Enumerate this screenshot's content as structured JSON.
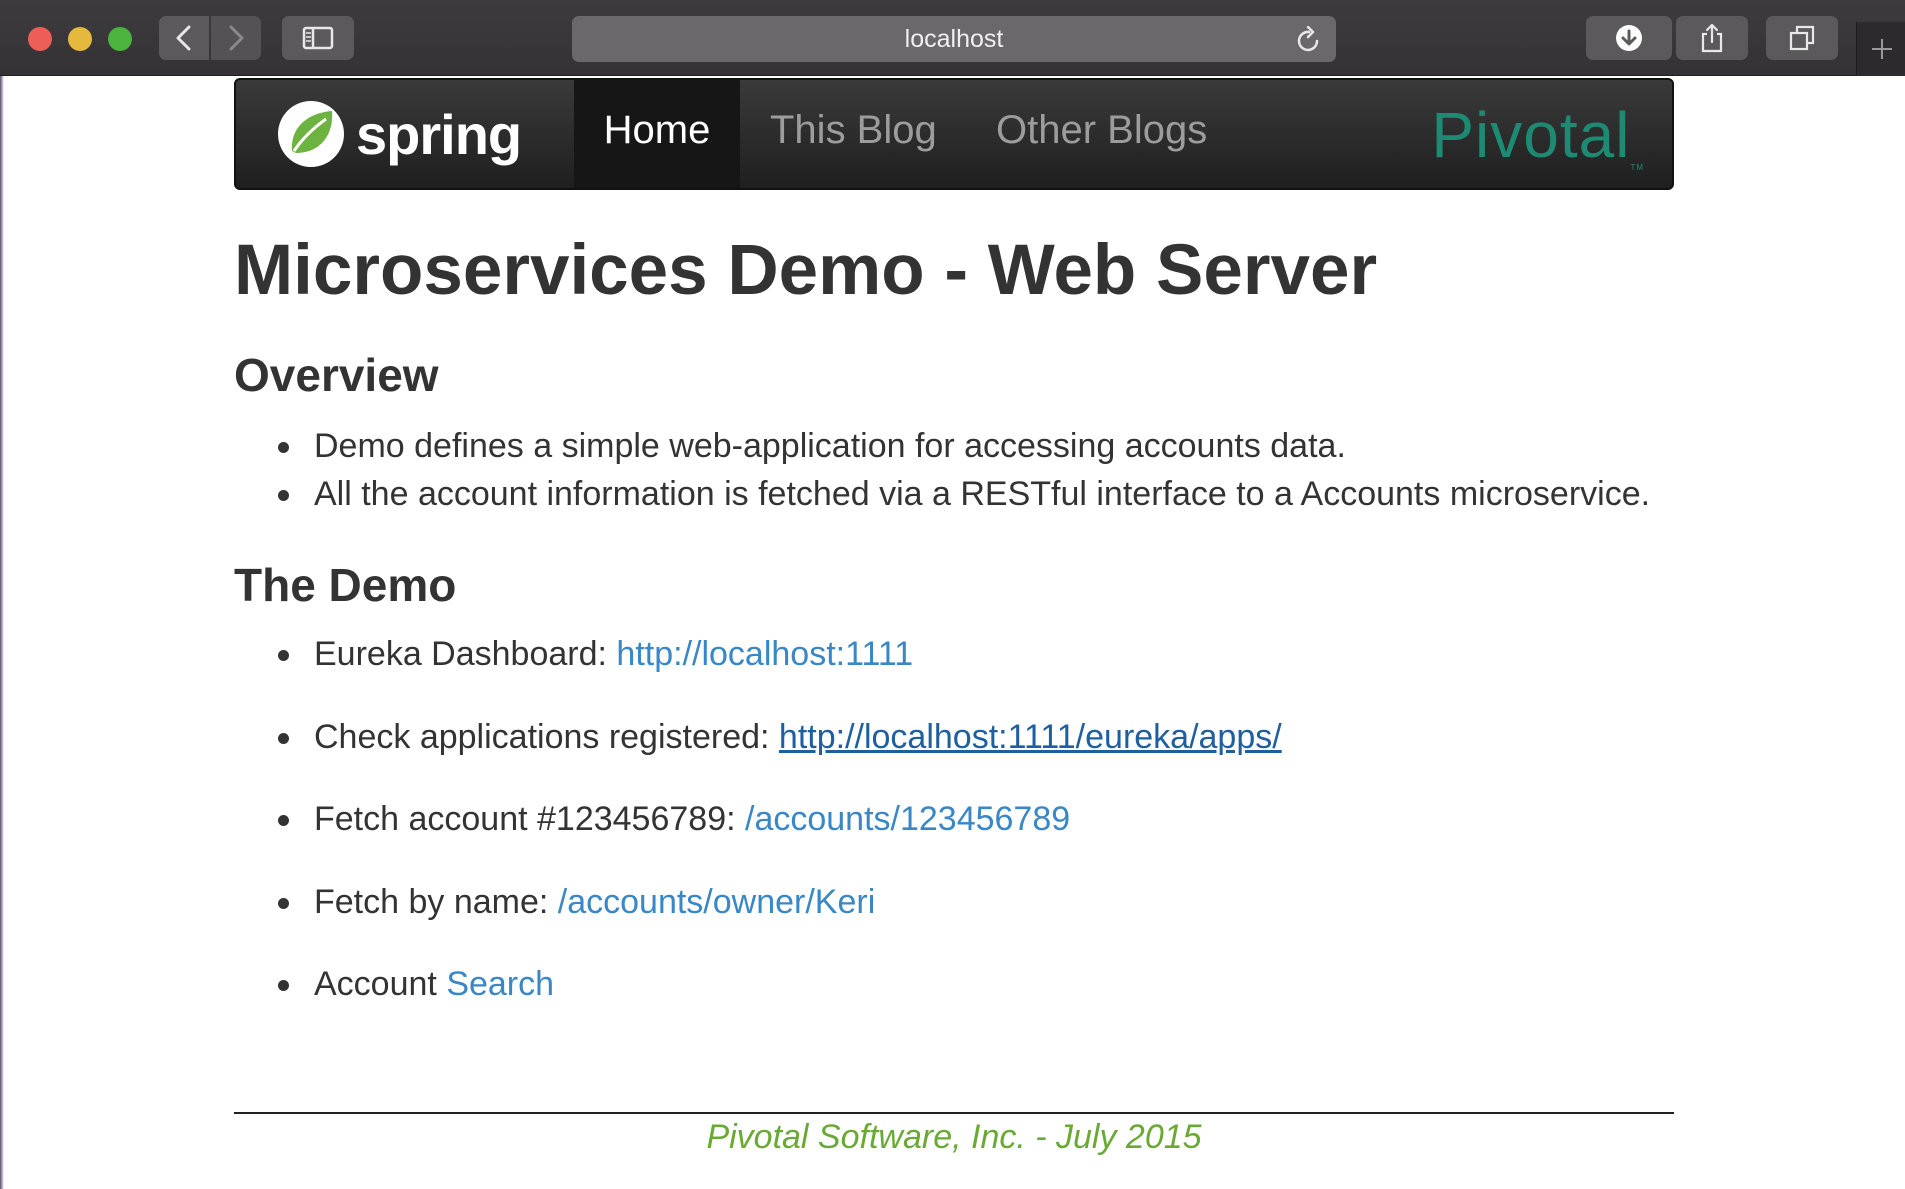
{
  "browser": {
    "url": "localhost",
    "icons": {
      "back": "chevron-left-icon",
      "forward": "chevron-right-icon",
      "sidebar": "sidebar-icon",
      "reload": "reload-icon",
      "download": "download-icon",
      "share": "share-icon",
      "tabs": "tabs-icon",
      "new_tab": "plus-icon"
    }
  },
  "navbar": {
    "brand": "spring",
    "items": [
      {
        "label": "Home",
        "active": true
      },
      {
        "label": "This Blog",
        "active": false
      },
      {
        "label": "Other Blogs",
        "active": false
      }
    ],
    "partner_logo": "Pivotal",
    "partner_logo_tm": "TM"
  },
  "page": {
    "title": "Microservices Demo - Web Server",
    "overview": {
      "heading": "Overview",
      "items": [
        "Demo defines a simple web-application for accessing accounts data.",
        "All the account information is fetched via a RESTful interface to a Accounts microservice."
      ]
    },
    "demo": {
      "heading": "The Demo",
      "items": [
        {
          "text": "Eureka Dashboard: ",
          "link": "http://localhost:1111"
        },
        {
          "text": "Check applications registered: ",
          "link": "http://localhost:1111/eureka/apps/"
        },
        {
          "text": "Fetch account #123456789: ",
          "link": "/accounts/123456789"
        },
        {
          "text": "Fetch by name: ",
          "link": "/accounts/owner/Keri"
        },
        {
          "text": "Account ",
          "link": "Search"
        }
      ]
    },
    "footer": "Pivotal Software, Inc. - July 2015"
  },
  "colors": {
    "link": "#3a87c7",
    "visited_link": "#1e5fa0",
    "footer": "#6aaa34",
    "pivotal": "#1d8a73"
  }
}
